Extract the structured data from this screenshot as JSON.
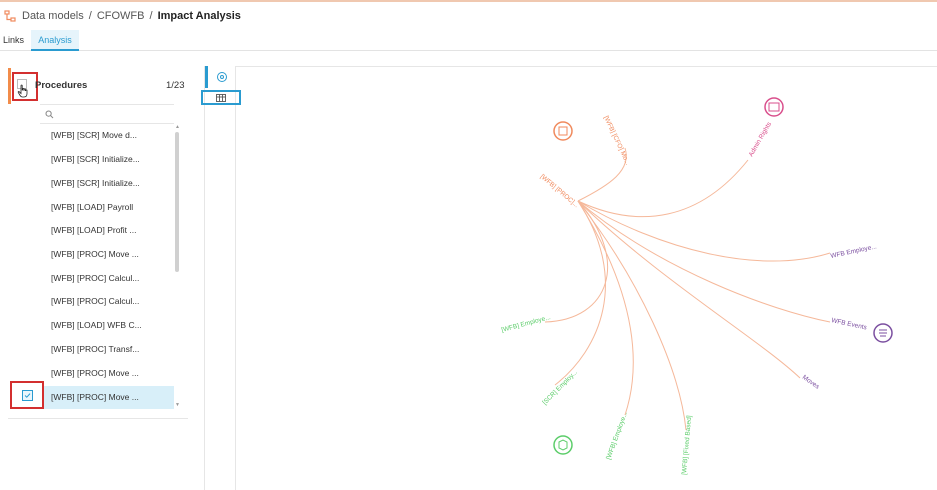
{
  "breadcrumb": {
    "items": [
      "Data models",
      "CFOWFB",
      "Impact Analysis"
    ],
    "separator": "/"
  },
  "tabs": [
    {
      "label": "Links",
      "active": false
    },
    {
      "label": "Analysis",
      "active": true
    }
  ],
  "procedures": {
    "title": "Procedures",
    "count": "1/23",
    "items": [
      {
        "label": "[WFB] [SCR] Move d...",
        "checked": false
      },
      {
        "label": "[WFB] [SCR] Initialize...",
        "checked": false
      },
      {
        "label": "[WFB] [SCR] Initialize...",
        "checked": false
      },
      {
        "label": "[WFB] [LOAD] Payroll",
        "checked": false
      },
      {
        "label": "[WFB] [LOAD] Profit ...",
        "checked": false
      },
      {
        "label": "[WFB] [PROC] Move ...",
        "checked": false
      },
      {
        "label": "[WFB] [PROC] Calcul...",
        "checked": false
      },
      {
        "label": "[WFB] [PROC] Calcul...",
        "checked": false
      },
      {
        "label": "[WFB] [LOAD] WFB C...",
        "checked": false
      },
      {
        "label": "[WFB] [PROC] Transf...",
        "checked": false
      },
      {
        "label": "[WFB] [PROC] Move ...",
        "checked": false
      },
      {
        "label": "[WFB] [PROC] Move ...",
        "checked": true
      }
    ]
  },
  "graph": {
    "center_label": "[WFB] [PROC]...",
    "labels": [
      "[WFB] [CFO] Mo...",
      "Admin Rights",
      "WFB Employe...",
      "WFB Events",
      "Moves",
      "[WFB] [Fixed Based]",
      "[WFB] Employe...",
      "[SCR] Employ...",
      "[WFB] Employe..."
    ],
    "colors": {
      "orange": "#f08a5d",
      "pink": "#d94f8c",
      "purple": "#7b4fa0",
      "green": "#5ccd6a",
      "link": "#f5b89a",
      "accent": "#2a9bd0",
      "highlight": "#d32f2f"
    }
  }
}
